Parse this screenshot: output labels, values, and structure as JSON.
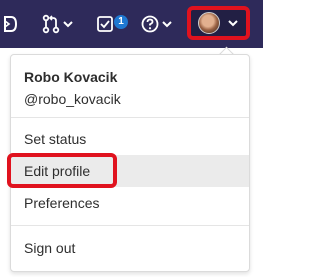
{
  "navbar": {
    "icons": [
      {
        "name": "ide-icon"
      },
      {
        "name": "merge-request-icon"
      },
      {
        "name": "todo-icon"
      },
      {
        "name": "help-icon"
      }
    ],
    "todo_badge": "1",
    "accent_color": "#2e2a5a",
    "badge_color": "#1f78d1",
    "highlight_color": "#e0121e"
  },
  "user_menu": {
    "name": "Robo Kovacik",
    "handle": "@robo_kovacik",
    "items": [
      {
        "label": "Set status"
      },
      {
        "label": "Edit profile"
      },
      {
        "label": "Preferences"
      },
      {
        "label": "Sign out"
      }
    ]
  }
}
